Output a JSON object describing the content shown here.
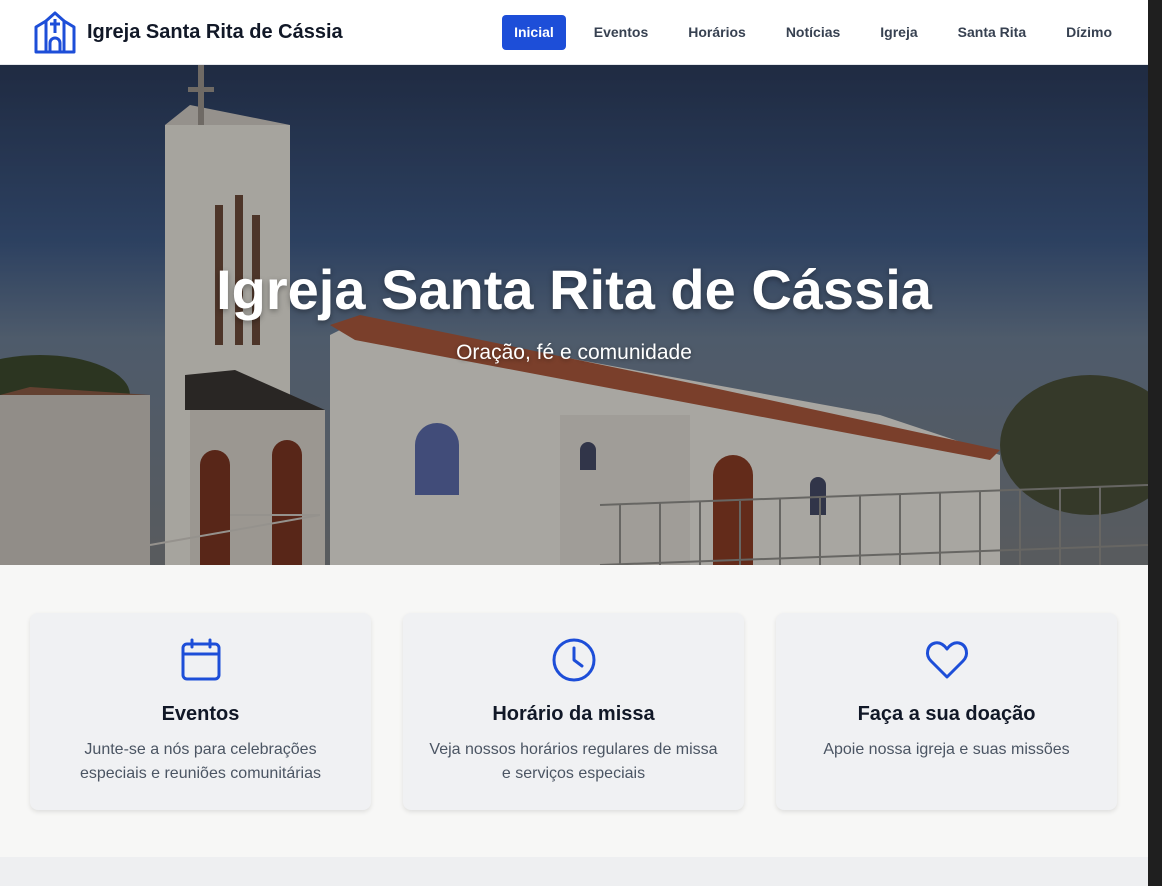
{
  "brand": {
    "name": "Igreja Santa Rita de Cássia",
    "logo_icon": "church-icon"
  },
  "nav": {
    "items": [
      {
        "label": "Inicial",
        "active": true
      },
      {
        "label": "Eventos"
      },
      {
        "label": "Horários"
      },
      {
        "label": "Notícias"
      },
      {
        "label": "Igreja"
      },
      {
        "label": "Santa Rita"
      },
      {
        "label": "Dízimo"
      }
    ]
  },
  "hero": {
    "title": "Igreja Santa Rita de Cássia",
    "subtitle": "Oração, fé e comunidade"
  },
  "cards": [
    {
      "icon": "calendar-icon",
      "title": "Eventos",
      "text": "Junte-se a nós para celebrações especiais e reuniões comunitárias"
    },
    {
      "icon": "clock-icon",
      "title": "Horário da missa",
      "text": "Veja nossos horários regulares de missa e serviços especiais"
    },
    {
      "icon": "heart-icon",
      "title": "Faça a sua doação",
      "text": "Apoie nossa igreja e suas missões"
    }
  ],
  "colors": {
    "accent": "#1d4ed8",
    "card_bg": "#f0f1f3",
    "page_bg": "#f7f7f6"
  }
}
